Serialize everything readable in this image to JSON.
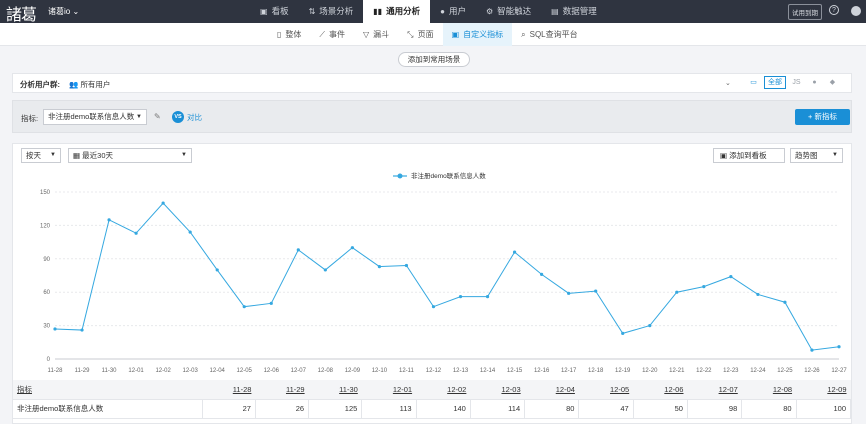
{
  "topbar": {
    "logo": "諸葛",
    "project": "诸葛io ⌄",
    "nav": [
      {
        "icon": "▣",
        "label": "看板",
        "active": false
      },
      {
        "icon": "⇅",
        "label": "场景分析",
        "active": false
      },
      {
        "icon": "▮▮",
        "label": "通用分析",
        "active": true
      },
      {
        "icon": "●",
        "label": "用户",
        "active": false
      },
      {
        "icon": "⚙",
        "label": "智能触达",
        "active": false
      },
      {
        "icon": "▤",
        "label": "数据管理",
        "active": false
      }
    ],
    "trial_label": "试用到期",
    "help_label": "?"
  },
  "subnav": {
    "tabs": [
      {
        "icon": "▯",
        "label": "整体",
        "active": false
      },
      {
        "icon": "⟋",
        "label": "事件",
        "active": false
      },
      {
        "icon": "▽",
        "label": "漏斗",
        "active": false
      },
      {
        "icon": "⤡",
        "label": "页面",
        "active": false
      },
      {
        "icon": "▣",
        "label": "自定义指标",
        "active": true
      },
      {
        "icon": "⌕",
        "label": "SQL查询平台",
        "active": false
      }
    ]
  },
  "scene_button": "添加到常用场景",
  "filter": {
    "label": "分析用户群:",
    "segment": "所有用户",
    "platform_all": "全部"
  },
  "metric": {
    "label": "指标:",
    "selected": "非注册demo联系信息人数",
    "vs": "VS",
    "compare_label": "对比",
    "new_button": "+ 新指标"
  },
  "controls": {
    "granularity": "按天",
    "date_range": "最近30天",
    "add_board": "添加到看板",
    "chart_type": "趋势图"
  },
  "colors": {
    "accent": "#1a8fd6",
    "line": "#35a8e0"
  },
  "chart_data": {
    "type": "line",
    "title": "",
    "xlabel": "",
    "ylabel": "",
    "ylim": [
      0,
      150
    ],
    "yticks": [
      0,
      30,
      60,
      90,
      120,
      150
    ],
    "grid": true,
    "legend_position": "top-center",
    "categories": [
      "11-28",
      "11-29",
      "11-30",
      "12-01",
      "12-02",
      "12-03",
      "12-04",
      "12-05",
      "12-06",
      "12-07",
      "12-08",
      "12-09",
      "12-10",
      "12-11",
      "12-12",
      "12-13",
      "12-14",
      "12-15",
      "12-16",
      "12-17",
      "12-18",
      "12-19",
      "12-20",
      "12-21",
      "12-22",
      "12-23",
      "12-24",
      "12-25",
      "12-26",
      "12-27"
    ],
    "series": [
      {
        "name": "非注册demo联系信息人数",
        "values": [
          27,
          26,
          125,
          113,
          140,
          114,
          80,
          47,
          50,
          98,
          80,
          100,
          83,
          84,
          47,
          56,
          56,
          96,
          76,
          59,
          61,
          23,
          30,
          60,
          65,
          74,
          58,
          51,
          8,
          11
        ]
      }
    ]
  },
  "table": {
    "header_label": "指标",
    "row_label": "非注册demo联系信息人数",
    "visible_columns": 12
  }
}
